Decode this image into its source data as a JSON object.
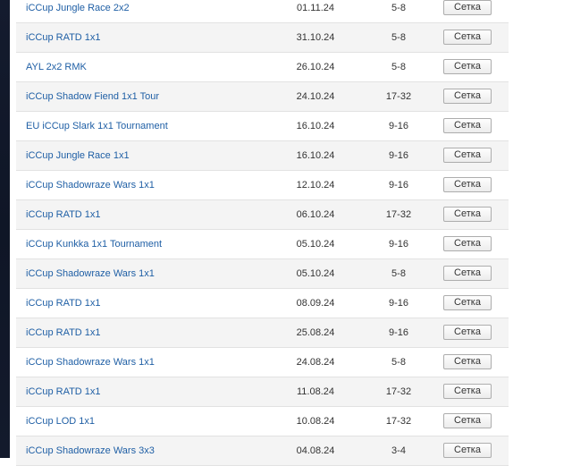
{
  "tournaments": [
    {
      "name": "iCCup Jungle Race 2x2",
      "date": "01.11.24",
      "players": "5-8",
      "bracket_label": "Сетка"
    },
    {
      "name": "iCCup RATD 1x1",
      "date": "31.10.24",
      "players": "5-8",
      "bracket_label": "Сетка"
    },
    {
      "name": "AYL 2x2 RMK",
      "date": "26.10.24",
      "players": "5-8",
      "bracket_label": "Сетка"
    },
    {
      "name": "iCCup Shadow Fiend 1x1 Tour",
      "date": "24.10.24",
      "players": "17-32",
      "bracket_label": "Сетка"
    },
    {
      "name": "EU iCCup Slark 1x1 Tournament",
      "date": "16.10.24",
      "players": "9-16",
      "bracket_label": "Сетка"
    },
    {
      "name": "iCCup Jungle Race 1x1",
      "date": "16.10.24",
      "players": "9-16",
      "bracket_label": "Сетка"
    },
    {
      "name": "iCCup Shadowraze Wars 1x1",
      "date": "12.10.24",
      "players": "9-16",
      "bracket_label": "Сетка"
    },
    {
      "name": "iCCup RATD 1x1",
      "date": "06.10.24",
      "players": "17-32",
      "bracket_label": "Сетка"
    },
    {
      "name": "iCCup Kunkka 1x1 Tournament",
      "date": "05.10.24",
      "players": "9-16",
      "bracket_label": "Сетка"
    },
    {
      "name": "iCCup Shadowraze Wars 1x1",
      "date": "05.10.24",
      "players": "5-8",
      "bracket_label": "Сетка"
    },
    {
      "name": "iCCup RATD 1x1",
      "date": "08.09.24",
      "players": "9-16",
      "bracket_label": "Сетка"
    },
    {
      "name": "iCCup RATD 1x1",
      "date": "25.08.24",
      "players": "9-16",
      "bracket_label": "Сетка"
    },
    {
      "name": "iCCup Shadowraze Wars 1x1",
      "date": "24.08.24",
      "players": "5-8",
      "bracket_label": "Сетка"
    },
    {
      "name": "iCCup RATD 1x1",
      "date": "11.08.24",
      "players": "17-32",
      "bracket_label": "Сетка"
    },
    {
      "name": "iCCup LOD 1x1",
      "date": "10.08.24",
      "players": "17-32",
      "bracket_label": "Сетка"
    },
    {
      "name": "iCCup Shadowraze Wars 3x3",
      "date": "04.08.24",
      "players": "3-4",
      "bracket_label": "Сетка"
    }
  ],
  "colors": {
    "link": "#1f5fa5",
    "row_alt": "#f4f4f4",
    "page_bg_dark": "#141b2e"
  }
}
